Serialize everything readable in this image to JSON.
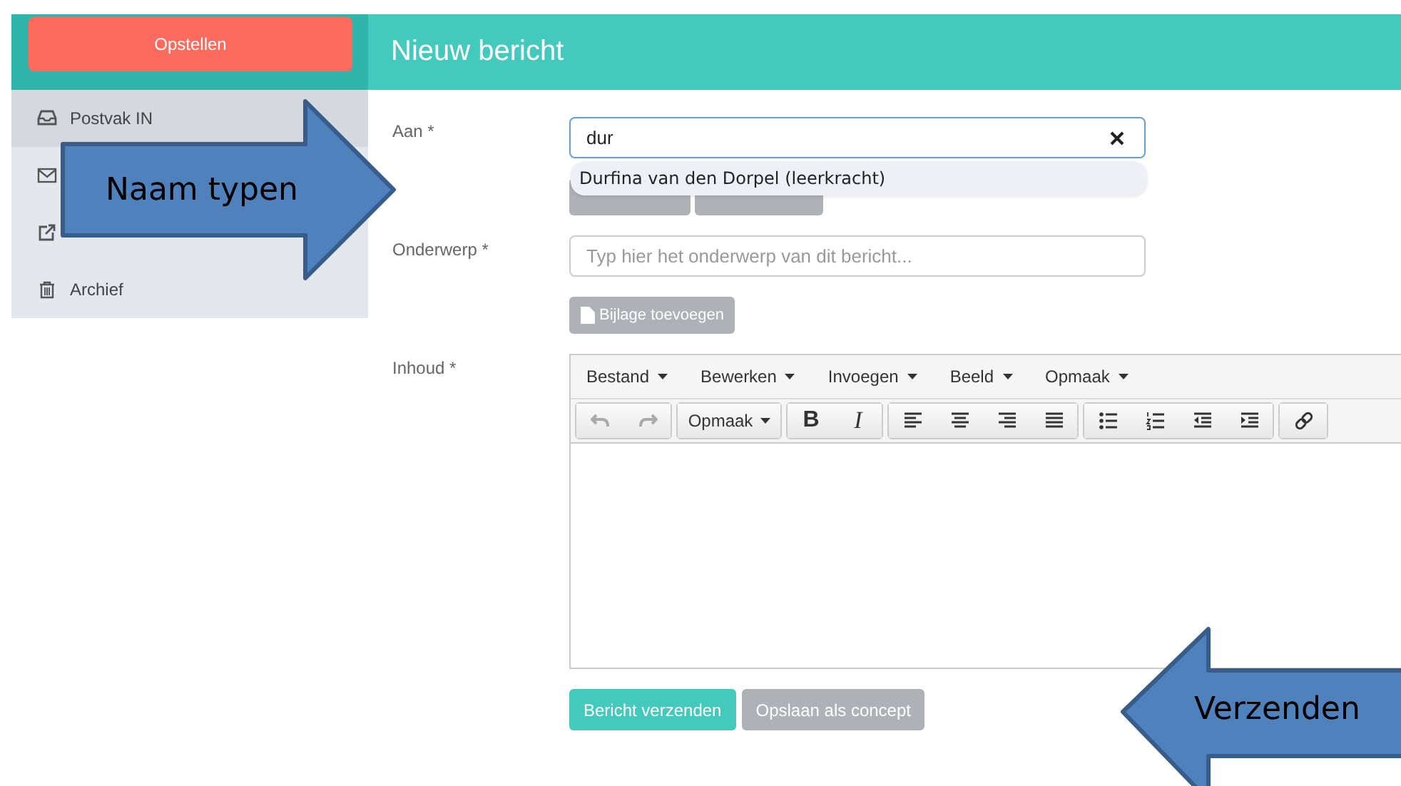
{
  "sidebar": {
    "compose_button": "Opstellen",
    "items": [
      {
        "label": "Postvak IN",
        "selected": true
      },
      {
        "selected": false
      },
      {
        "selected": false
      },
      {
        "label": "Archief",
        "selected": false
      }
    ]
  },
  "header": {
    "title": "Nieuw bericht"
  },
  "form": {
    "to": {
      "label": "Aan *",
      "value": "dur",
      "suggestions": [
        "Durfina van den Dorpel (leerkracht)"
      ]
    },
    "subject": {
      "label": "Onderwerp *",
      "placeholder": "Typ hier het onderwerp van dit bericht..."
    },
    "attachment_button": "Bijlage toevoegen",
    "content": {
      "label": "Inhoud *",
      "menu": [
        "Bestand",
        "Bewerken",
        "Invoegen",
        "Beeld",
        "Opmaak"
      ],
      "toolbar": [
        [
          {
            "kind": "undo",
            "disabled": true
          },
          {
            "kind": "redo",
            "disabled": true
          }
        ],
        [
          {
            "kind": "dropdown",
            "label": "Opmaak"
          }
        ],
        [
          {
            "kind": "bold",
            "label": "B"
          },
          {
            "kind": "italic",
            "label": "I"
          }
        ],
        [
          {
            "kind": "align-left"
          },
          {
            "kind": "align-center"
          },
          {
            "kind": "align-right"
          },
          {
            "kind": "justify"
          }
        ],
        [
          {
            "kind": "bullets"
          },
          {
            "kind": "numbers"
          },
          {
            "kind": "outdent"
          },
          {
            "kind": "indent"
          }
        ],
        [
          {
            "kind": "link"
          }
        ]
      ]
    },
    "buttons": [
      {
        "label": "Bericht verzenden",
        "kind": "primary"
      },
      {
        "label": "Opslaan als concept",
        "kind": "secondary"
      }
    ]
  },
  "annotations": [
    {
      "text": "Naam typen",
      "kind": "right"
    },
    {
      "text": "Verzenden",
      "kind": "left"
    }
  ]
}
